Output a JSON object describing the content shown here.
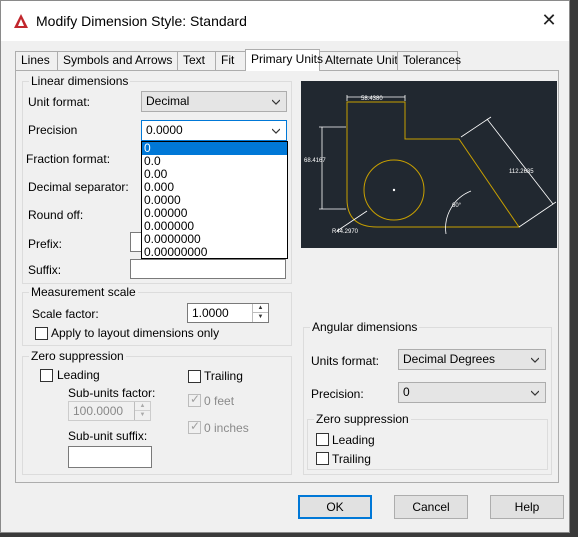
{
  "window": {
    "title": "Modify Dimension Style: Standard",
    "close_glyph": "✕"
  },
  "tabs": [
    "Lines",
    "Symbols and Arrows",
    "Text",
    "Fit",
    "Primary Units",
    "Alternate Units",
    "Tolerances"
  ],
  "active_tab": "Primary Units",
  "linear": {
    "group_title": "Linear dimensions",
    "unit_format_label": "Unit format:",
    "unit_format_value": "Decimal",
    "precision_label": "Precision",
    "precision_value": "0.0000",
    "fraction_format_label": "Fraction format:",
    "decimal_separator_label": "Decimal separator:",
    "round_off_label": "Round off:",
    "prefix_label": "Prefix:",
    "suffix_label": "Suffix:"
  },
  "precision_options": [
    "0",
    "0.0",
    "0.00",
    "0.000",
    "0.0000",
    "0.00000",
    "0.000000",
    "0.0000000",
    "0.00000000"
  ],
  "precision_highlighted": "0",
  "measurement": {
    "group_title": "Measurement scale",
    "scale_factor_label": "Scale factor:",
    "scale_factor_value": "1.0000",
    "layout_only_label": "Apply to layout dimensions only"
  },
  "zero_suppression": {
    "group_title": "Zero suppression",
    "leading_label": "Leading",
    "trailing_label": "Trailing",
    "sub_units_factor_label": "Sub-units factor:",
    "sub_units_factor_value": "100.0000",
    "feet_label": "0 feet",
    "inches_label": "0 inches",
    "sub_unit_suffix_label": "Sub-unit suffix:"
  },
  "preview": {
    "dim_top": "58.4380",
    "dim_left": "68.4167",
    "dim_right": "112.2635",
    "dim_angle": "60°",
    "dim_radius": "R44.2970"
  },
  "angular": {
    "group_title": "Angular dimensions",
    "units_format_label": "Units format:",
    "units_format_value": "Decimal Degrees",
    "precision_label": "Precision:",
    "precision_value": "0",
    "zero_group_title": "Zero suppression",
    "leading_label": "Leading",
    "trailing_label": "Trailing"
  },
  "buttons": {
    "ok": "OK",
    "cancel": "Cancel",
    "help": "Help"
  },
  "colors": {
    "accent": "#0078d7",
    "preview_bg": "#212830",
    "geometry": "#c8a000",
    "dim_line": "#ffffff",
    "app_icon": "#c1272d"
  }
}
